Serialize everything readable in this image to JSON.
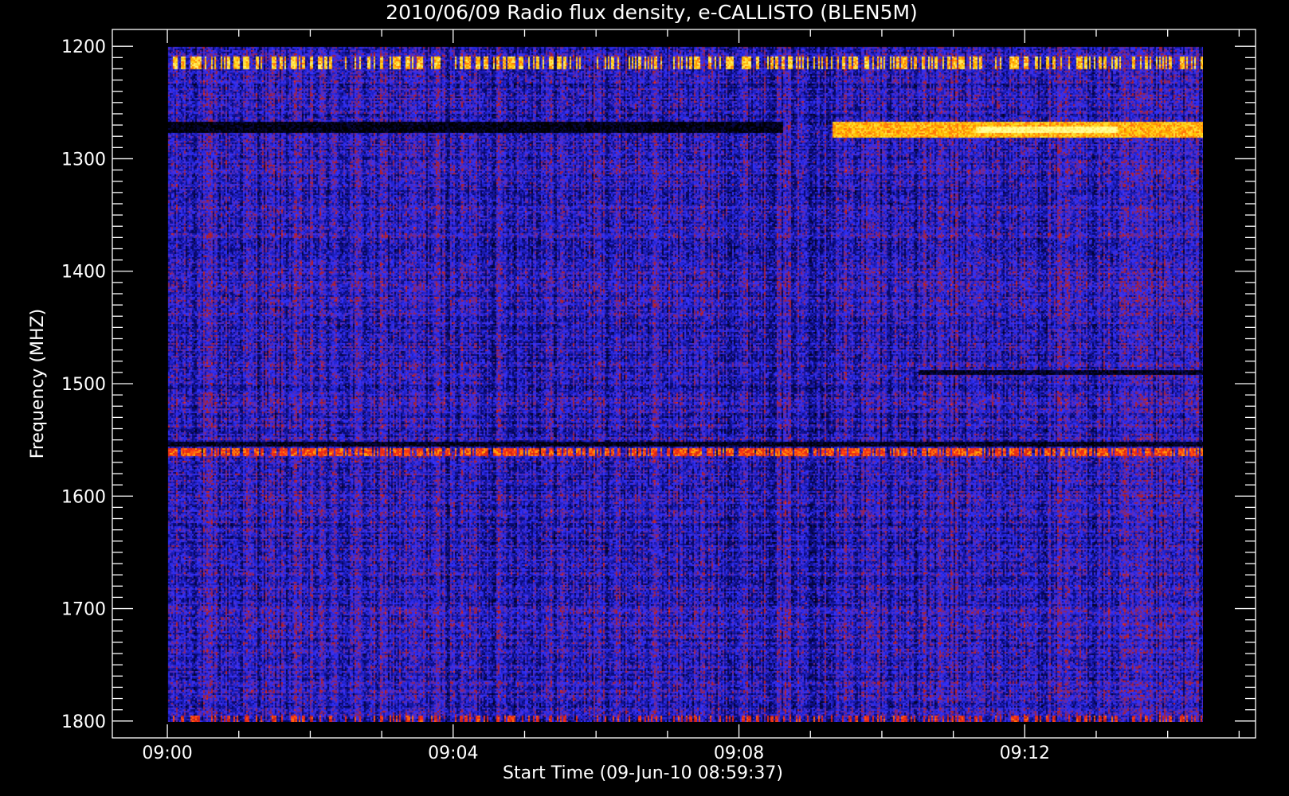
{
  "chart_data": {
    "type": "heatmap",
    "title": "2010/06/09  Radio flux density, e-CALLISTO (BLEN5M)",
    "xlabel": "Start Time (09-Jun-10 08:59:37)",
    "ylabel": "Frequency (MHZ)",
    "x_ticks": [
      "09:00",
      "09:04",
      "09:08",
      "09:12"
    ],
    "x_tick_minutes": [
      0,
      4,
      8,
      12
    ],
    "xlim_minutes": [
      -0.77,
      15.23
    ],
    "x_end_of_data_minutes": 15.0,
    "y_ticks": [
      1200,
      1300,
      1400,
      1500,
      1600,
      1700,
      1800
    ],
    "ylim": [
      1185,
      1815
    ],
    "y_data_range": [
      1200,
      1800
    ],
    "y_reversed": true,
    "background": "#000000",
    "axis_color": "#ffffff",
    "colormap": [
      "#000000",
      "#0a0a78",
      "#3232ff",
      "#b41e1e",
      "#ff3214",
      "#ffc800",
      "#ffff96"
    ],
    "base_level": 0.28,
    "features": [
      {
        "desc": "intermittent interference spikes",
        "freq_mhz": [
          1208,
          1220
        ],
        "time_min": [
          0.0,
          15.0
        ],
        "level": 0.85,
        "sparse": 0.45
      },
      {
        "desc": "dark band",
        "freq_mhz": [
          1267,
          1277
        ],
        "time_min": [
          0.0,
          8.6
        ],
        "level": 0.02
      },
      {
        "desc": "persistent bright emission band",
        "freq_mhz": [
          1266,
          1280
        ],
        "time_min": [
          9.3,
          15.0
        ],
        "level": 0.82
      },
      {
        "desc": "bright core of emission band",
        "freq_mhz": [
          1270,
          1276
        ],
        "time_min": [
          11.3,
          13.3
        ],
        "level": 1.0
      },
      {
        "desc": "narrow interference line",
        "freq_mhz": [
          1557,
          1563
        ],
        "time_min": [
          0.0,
          15.0
        ],
        "level": 0.68,
        "sparse": 0.7
      },
      {
        "desc": "dark line",
        "freq_mhz": [
          1551,
          1555
        ],
        "time_min": [
          0.0,
          15.0
        ],
        "level": 0.04
      },
      {
        "desc": "dark line",
        "freq_mhz": [
          1487,
          1491
        ],
        "time_min": [
          10.5,
          15.0
        ],
        "level": 0.05
      },
      {
        "desc": "bottom edge interference",
        "freq_mhz": [
          1794,
          1800
        ],
        "time_min": [
          0.0,
          15.0
        ],
        "level": 0.62,
        "sparse": 0.35
      }
    ]
  }
}
